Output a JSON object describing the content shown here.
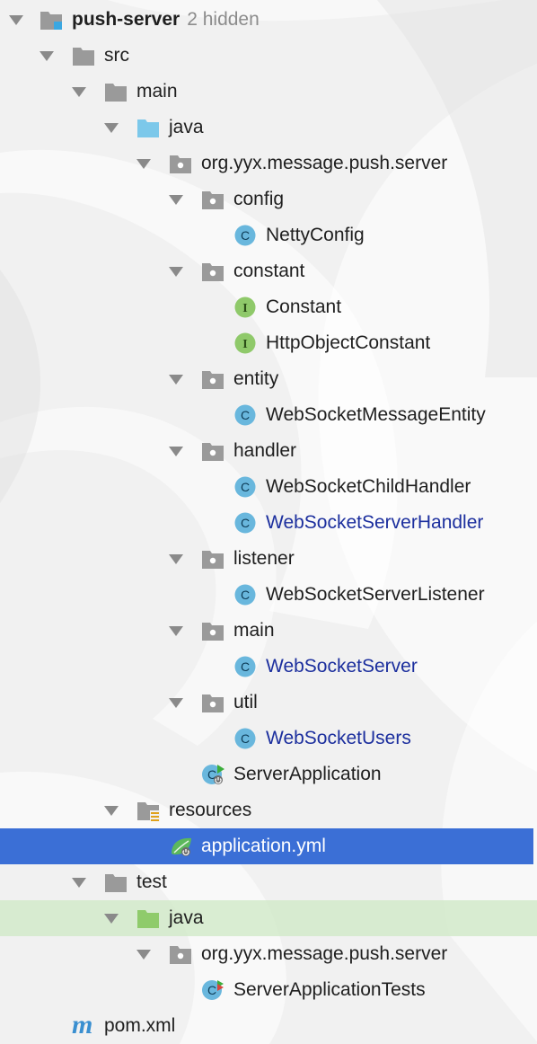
{
  "project": {
    "name": "push-server",
    "hidden_note": "2 hidden"
  },
  "tree": {
    "src": "src",
    "main": "main",
    "java": "java",
    "package": "org.yyx.message.push.server",
    "config": "config",
    "netty_config": "NettyConfig",
    "constant": "constant",
    "constant_class": "Constant",
    "http_object_constant": "HttpObjectConstant",
    "entity": "entity",
    "ws_message_entity": "WebSocketMessageEntity",
    "handler": "handler",
    "ws_child_handler": "WebSocketChildHandler",
    "ws_server_handler": "WebSocketServerHandler",
    "listener": "listener",
    "ws_server_listener": "WebSocketServerListener",
    "main_pkg": "main",
    "ws_server": "WebSocketServer",
    "util": "util",
    "ws_users": "WebSocketUsers",
    "server_application": "ServerApplication",
    "resources": "resources",
    "application_yml": "application.yml",
    "test": "test",
    "test_java": "java",
    "test_package": "org.yyx.message.push.server",
    "server_application_tests": "ServerApplicationTests",
    "pom": "pom.xml"
  },
  "icon_letters": {
    "class": "C",
    "interface": "I",
    "maven": "m"
  },
  "colors": {
    "selection": "#3b6fd6",
    "modified_text": "#1c2f9e",
    "class_icon": "#69b7dd",
    "interface_icon": "#8fc96a",
    "folder": "#9a9a9a",
    "source_folder": "#7cc8ea",
    "test_folder": "#8fcb6b",
    "test_band": "#cee8c4"
  }
}
